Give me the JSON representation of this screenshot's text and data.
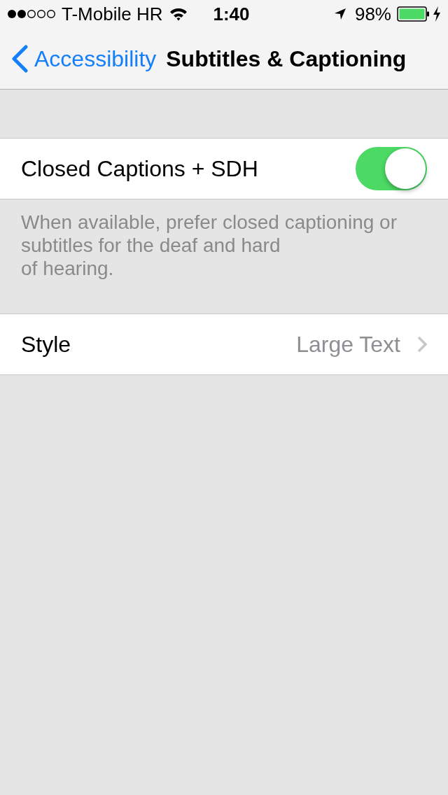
{
  "status_bar": {
    "carrier": "T-Mobile HR",
    "time": "1:40",
    "battery_percent": "98%"
  },
  "nav_bar": {
    "back_label": "Accessibility",
    "title": "Subtitles & Captioning"
  },
  "sections": [
    {
      "rows": [
        {
          "kind": "toggle",
          "label": "Closed Captions + SDH",
          "on": true
        }
      ],
      "footer": "When available, prefer closed captioning or subtitles for the deaf and hard\nof hearing."
    },
    {
      "rows": [
        {
          "kind": "disclosure",
          "label": "Style",
          "value": "Large Text"
        }
      ]
    }
  ]
}
